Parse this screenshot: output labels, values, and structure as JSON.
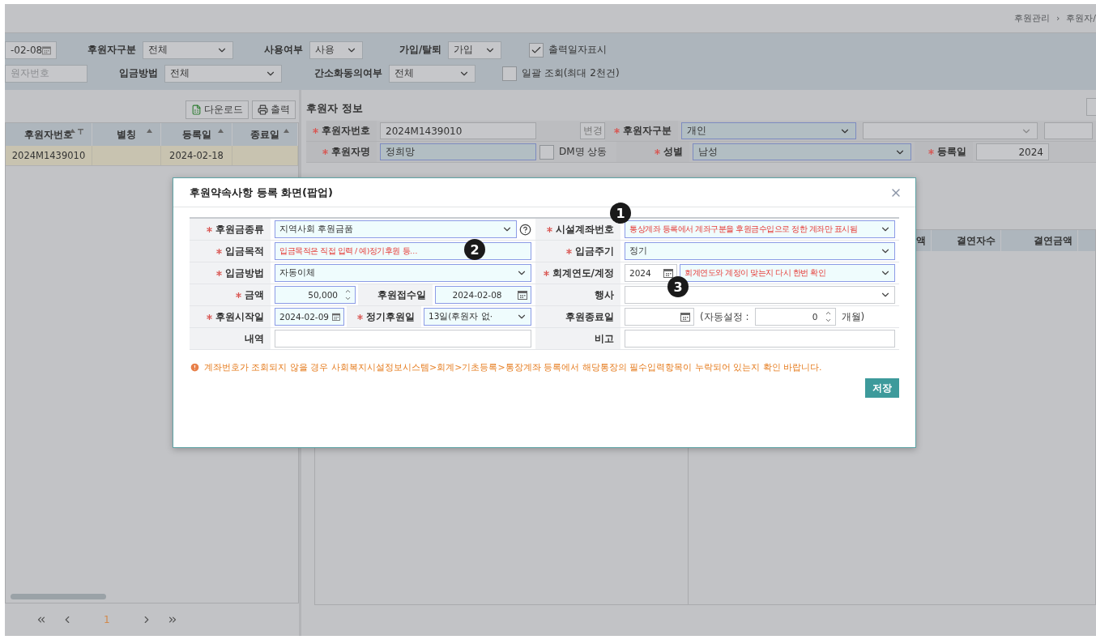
{
  "breadcrumb": {
    "items": [
      "후원관리",
      "후원자/"
    ],
    "separator": "›"
  },
  "filters": [
    [
      {
        "kind": "date",
        "value": "-02-08"
      },
      {
        "kind": "select",
        "label": "후원자구분",
        "value": "전체"
      },
      {
        "kind": "select",
        "label": "사용여부",
        "value": "사용"
      },
      {
        "kind": "select",
        "label": "가입/탈퇴",
        "value": "가입"
      },
      {
        "kind": "checkbox",
        "label": "출력일자표시",
        "checked": true
      }
    ],
    [
      {
        "kind": "text",
        "placeholder": "원자번호"
      },
      {
        "kind": "select",
        "label": "입금방법",
        "value": "전체"
      },
      {
        "kind": "select",
        "label": "간소화동의여부",
        "value": "전체"
      },
      {
        "kind": "checkbox",
        "label": "일괄 조회(최대 2천건)",
        "checked": false
      }
    ]
  ],
  "list_panel": {
    "buttons": [
      {
        "label": "다운로드"
      },
      {
        "label": "출력"
      }
    ],
    "columns": [
      {
        "label": "후원자번호",
        "filter": true
      },
      {
        "label": "별칭",
        "filter": false
      },
      {
        "label": "등록일",
        "filter": false
      },
      {
        "label": "종료일",
        "filter": false
      }
    ],
    "rows": [
      {
        "number": "2024M1439010",
        "date": "2024-02-18",
        "selected": true
      }
    ],
    "pages": [
      {
        "label": "1",
        "selected": true
      }
    ]
  },
  "donor_info": {
    "title": "후원자 정보",
    "number_label": "후원자번호",
    "number": "2024M1439010",
    "change_button": "변경",
    "type_label": "후원자구분",
    "type": "개인",
    "name_label": "후원자명",
    "name": "정희망",
    "dm_same": {
      "label": "DM명 상동",
      "checked": false
    },
    "gender_label": "성별",
    "gender": "남성",
    "reg_label": "등록일",
    "reg_date": "2024"
  },
  "result_table": {
    "columns": [
      "액",
      "결연자수",
      "결연금액"
    ]
  },
  "modal": {
    "title": "후원약속사항 등록 화면(팝업)",
    "rows": [
      {
        "left": {
          "label": "후원금종류",
          "required": true,
          "items": [
            {
              "kind": "select",
              "value": "지역사회 후원금품"
            },
            {
              "kind": "help"
            }
          ]
        },
        "right": {
          "label": "시설계좌번호",
          "required": true,
          "items": [
            {
              "kind": "select",
              "value": "통상계좌 등록에서 계좌구분을 후원금수입으로 정한 계좌만 표시됨",
              "hint": true
            }
          ]
        }
      },
      {
        "left": {
          "label": "입금목적",
          "required": true,
          "items": [
            {
              "kind": "input",
              "value": "입금목적은 직접 입력 / 예)정기후원 등…",
              "hint": true
            }
          ]
        },
        "right": {
          "label": "입금주기",
          "required": true,
          "items": [
            {
              "kind": "select",
              "value": "정기"
            }
          ]
        }
      },
      {
        "left": {
          "label": "입금방법",
          "required": true,
          "items": [
            {
              "kind": "select",
              "value": "자동이체"
            }
          ]
        },
        "right": {
          "label": "회계연도/계정",
          "required": true,
          "items": [
            {
              "kind": "year",
              "value": "2024"
            },
            {
              "kind": "select",
              "value": "회계연도와 계정이 맞는지 다시 한번 확인",
              "hint": true
            }
          ]
        }
      },
      {
        "left": {
          "label": "금액",
          "required": true,
          "items": [
            {
              "kind": "spinner",
              "value": "50,000"
            },
            {
              "kind": "label",
              "text": "후원접수일",
              "required": false
            },
            {
              "kind": "date",
              "value": "2024-02-08"
            }
          ]
        },
        "right": {
          "label": "행사",
          "required": false,
          "items": [
            {
              "kind": "select"
            }
          ]
        }
      },
      {
        "left": {
          "label": "후원시작일",
          "required": true,
          "items": [
            {
              "kind": "date",
              "value": "2024-02-09"
            },
            {
              "kind": "label",
              "text": "정기후원일",
              "required": true
            },
            {
              "kind": "select",
              "value": "13일(후원자 없·"
            }
          ]
        },
        "right": {
          "label": "후원종료일",
          "required": false,
          "items": [
            {
              "kind": "date"
            },
            {
              "kind": "text",
              "text": "(자동설정 :"
            },
            {
              "kind": "spinner",
              "value": "0"
            },
            {
              "kind": "text",
              "text": "개월)"
            }
          ]
        }
      },
      {
        "left": {
          "label": "내역",
          "required": false,
          "items": [
            {
              "kind": "input"
            }
          ]
        },
        "right": {
          "label": "비고",
          "required": false,
          "items": [
            {
              "kind": "input"
            }
          ]
        }
      }
    ],
    "notice": "계좌번호가 조회되지 않을 경우 사회복지시설정보시스템>회계>기초등록>통장계좌 등록에서 해당통장의 필수입력항목이 누락되어 있는지 확인 바랍니다.",
    "save_button": "저장",
    "markers": [
      {
        "label": "1"
      },
      {
        "label": "2"
      },
      {
        "label": "3"
      }
    ]
  }
}
